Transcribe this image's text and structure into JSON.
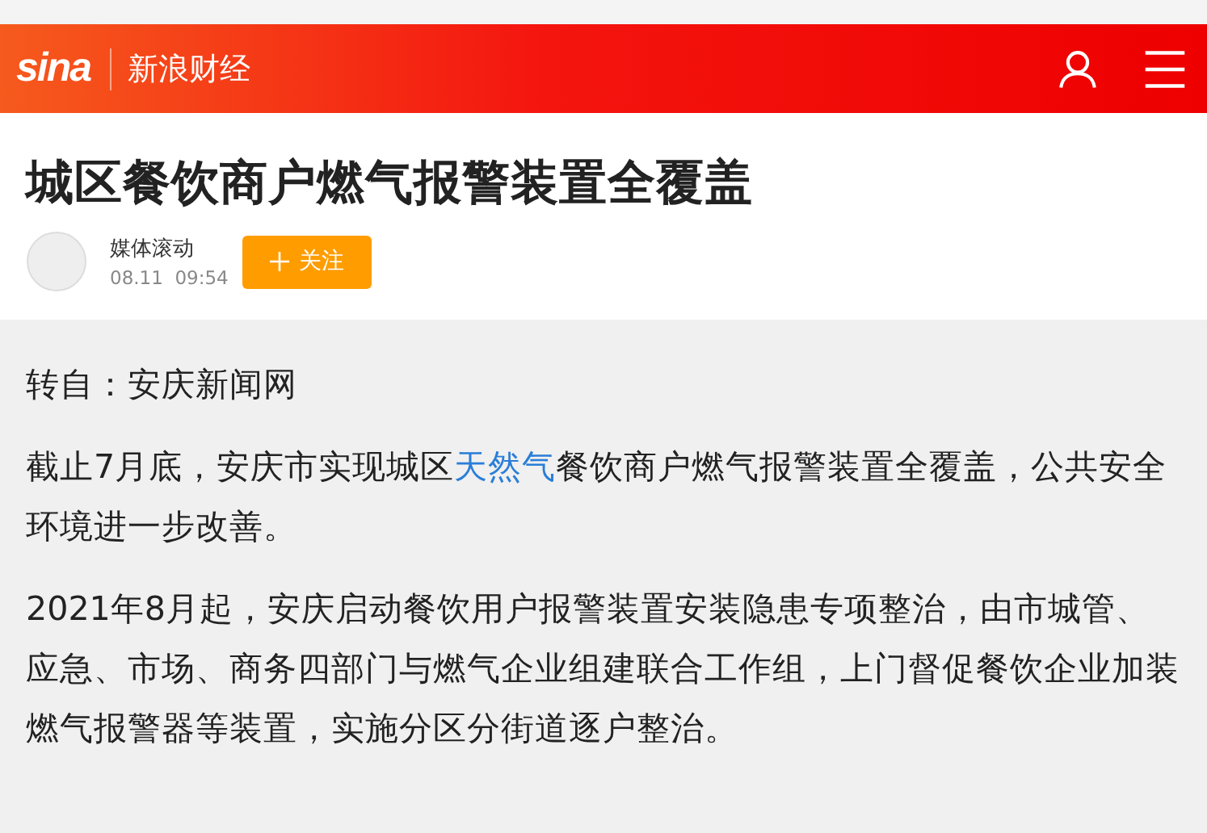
{
  "header": {
    "logo": "sina",
    "channel": "新浪财经"
  },
  "article": {
    "title": "城区餐饮商户燃气报警装置全覆盖",
    "author": "媒体滚动",
    "time": "08.11  09:54",
    "follow_button": "关注",
    "paragraphs": [
      {
        "parts": [
          {
            "kind": "text",
            "text": "转自：安庆新闻网"
          }
        ]
      },
      {
        "parts": [
          {
            "kind": "text",
            "text": "截止7月底，安庆市实现城区"
          },
          {
            "kind": "link",
            "text": "天然气"
          },
          {
            "kind": "text",
            "text": "餐饮商户燃气报警装置全覆盖，公共安全环境进一步改善。"
          }
        ]
      },
      {
        "parts": [
          {
            "kind": "text",
            "text": "2021年8月起，安庆启动餐饮用户报警装置安装隐患专项整治，由市城管、应急、市场、商务四部门与燃气企业组建联合工作组，上门督促餐饮企业加装燃气报警器等装置，实施分区分街道逐户整治。"
          }
        ]
      }
    ]
  }
}
